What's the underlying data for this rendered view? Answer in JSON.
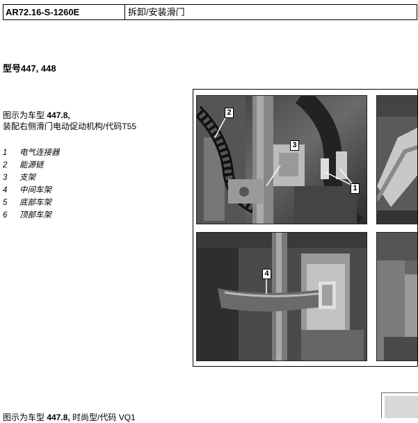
{
  "header": {
    "code": "AR72.16-S-1260E",
    "title": "拆卸/安装滑门"
  },
  "model_heading": "型号447, 448",
  "caption": {
    "line1_prefix": "图示为车型 ",
    "line1_model": "447.8,",
    "line2_prefix": "装配右侧滑门电动促动机构/代码",
    "line2_code": "T55"
  },
  "legend": [
    {
      "num": "1",
      "label": "电气连接器"
    },
    {
      "num": "2",
      "label": "能源链"
    },
    {
      "num": "3",
      "label": "支架"
    },
    {
      "num": "4",
      "label": "中间车架"
    },
    {
      "num": "5",
      "label": "底部车架"
    },
    {
      "num": "6",
      "label": "顶部车架"
    }
  ],
  "callouts": {
    "c1": "1",
    "c2": "2",
    "c3": "3",
    "c4": "4"
  },
  "bottom_text": {
    "prefix": "图示为车型 ",
    "model": "447.8,",
    "rest": " 时尚型/代码 VQ1"
  }
}
